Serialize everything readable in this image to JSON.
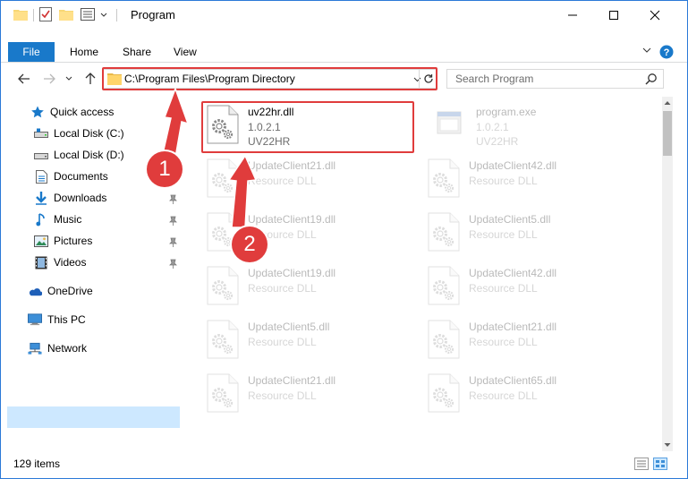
{
  "window": {
    "title": "Program"
  },
  "ribbon": {
    "file": "File",
    "tabs": [
      "Home",
      "Share",
      "View"
    ]
  },
  "address": {
    "path": "C:\\Program Files\\Program Directory"
  },
  "search": {
    "placeholder": "Search Program"
  },
  "sidebar": {
    "items": [
      {
        "label": "Quick access",
        "icon": "star-icon"
      },
      {
        "label": "Local Disk (C:)",
        "icon": "drive-icon"
      },
      {
        "label": "Local Disk (D:)",
        "icon": "drive-icon"
      },
      {
        "label": "Documents",
        "icon": "documents-icon"
      },
      {
        "label": "Downloads",
        "icon": "download-icon"
      },
      {
        "label": "Music",
        "icon": "music-icon"
      },
      {
        "label": "Pictures",
        "icon": "pictures-icon"
      },
      {
        "label": "Videos",
        "icon": "videos-icon"
      },
      {
        "label": "OneDrive",
        "icon": "cloud-icon"
      },
      {
        "label": "This PC",
        "icon": "computer-icon"
      },
      {
        "label": "Network",
        "icon": "network-icon"
      }
    ]
  },
  "files": [
    {
      "name": "uv22hr.dll",
      "line2": "1.0.2.1",
      "line3": "UV22HR",
      "icon": "dll-icon",
      "dim": false
    },
    {
      "name": "program.exe",
      "line2": "1.0.2.1",
      "line3": "UV22HR",
      "icon": "exe-icon",
      "dim": true
    },
    {
      "name": "UpdateClient21.dll",
      "line2": "Resource DLL",
      "line3": "",
      "icon": "dll-icon",
      "dim": true
    },
    {
      "name": "UpdateClient42.dll",
      "line2": "Resource DLL",
      "line3": "",
      "icon": "dll-icon",
      "dim": true
    },
    {
      "name": "UpdateClient19.dll",
      "line2": "Resource DLL",
      "line3": "",
      "icon": "dll-icon",
      "dim": true
    },
    {
      "name": "UpdateClient5.dll",
      "line2": "Resource DLL",
      "line3": "",
      "icon": "dll-icon",
      "dim": true
    },
    {
      "name": "UpdateClient19.dll",
      "line2": "Resource DLL",
      "line3": "",
      "icon": "dll-icon",
      "dim": true
    },
    {
      "name": "UpdateClient42.dll",
      "line2": "Resource DLL",
      "line3": "",
      "icon": "dll-icon",
      "dim": true
    },
    {
      "name": "UpdateClient5.dll",
      "line2": "Resource DLL",
      "line3": "",
      "icon": "dll-icon",
      "dim": true
    },
    {
      "name": "UpdateClient21.dll",
      "line2": "Resource DLL",
      "line3": "",
      "icon": "dll-icon",
      "dim": true
    },
    {
      "name": "UpdateClient21.dll",
      "line2": "Resource DLL",
      "line3": "",
      "icon": "dll-icon",
      "dim": true
    },
    {
      "name": "UpdateClient65.dll",
      "line2": "Resource DLL",
      "line3": "",
      "icon": "dll-icon",
      "dim": true
    }
  ],
  "status": {
    "item_count": "129 items"
  },
  "annotations": {
    "step1": "1",
    "step2": "2"
  },
  "colors": {
    "accent": "#1979ca",
    "highlight": "#e03c3c",
    "selected": "#cde8ff"
  }
}
